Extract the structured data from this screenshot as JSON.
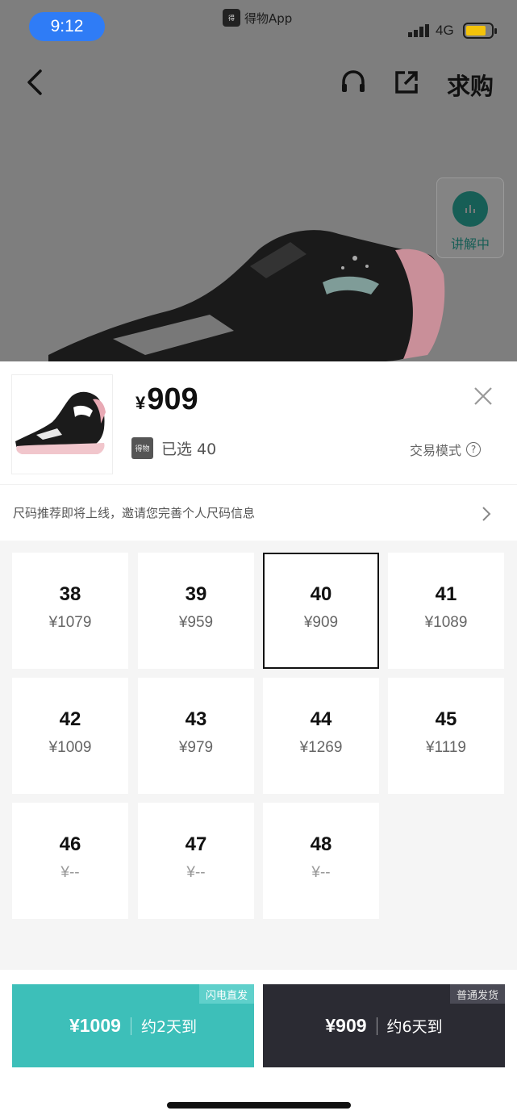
{
  "status_bar": {
    "time": "9:12",
    "app_name": "得物App",
    "network": "4G",
    "battery_color": "#f4c30a"
  },
  "nav": {
    "want_label": "求购",
    "back_icon": "chevron-left-icon",
    "service_icon": "headset-icon",
    "share_icon": "share-icon"
  },
  "live_badge": {
    "label": "讲解中"
  },
  "product": {
    "currency": "¥",
    "price": "909",
    "logo_text": "得物",
    "selected_label": "已选 40",
    "trade_mode_label": "交易模式",
    "help_glyph": "?"
  },
  "hint": {
    "text": "尺码推荐即将上线，邀请您完善个人尺码信息"
  },
  "sizes": [
    {
      "size": "38",
      "price": "¥1079"
    },
    {
      "size": "39",
      "price": "¥959"
    },
    {
      "size": "40",
      "price": "¥909",
      "selected": true
    },
    {
      "size": "41",
      "price": "¥1089"
    },
    {
      "size": "42",
      "price": "¥1009"
    },
    {
      "size": "43",
      "price": "¥979"
    },
    {
      "size": "44",
      "price": "¥1269"
    },
    {
      "size": "45",
      "price": "¥1119"
    },
    {
      "size": "46",
      "price": "¥--"
    },
    {
      "size": "47",
      "price": "¥--"
    },
    {
      "size": "48",
      "price": "¥--"
    }
  ],
  "buy_options": [
    {
      "tag": "闪电直发",
      "price": "¥1009",
      "eta": "约2天到",
      "color": "#3dbfb9"
    },
    {
      "tag": "普通发货",
      "price": "¥909",
      "eta": "约6天到",
      "color": "#2b2b33"
    }
  ]
}
